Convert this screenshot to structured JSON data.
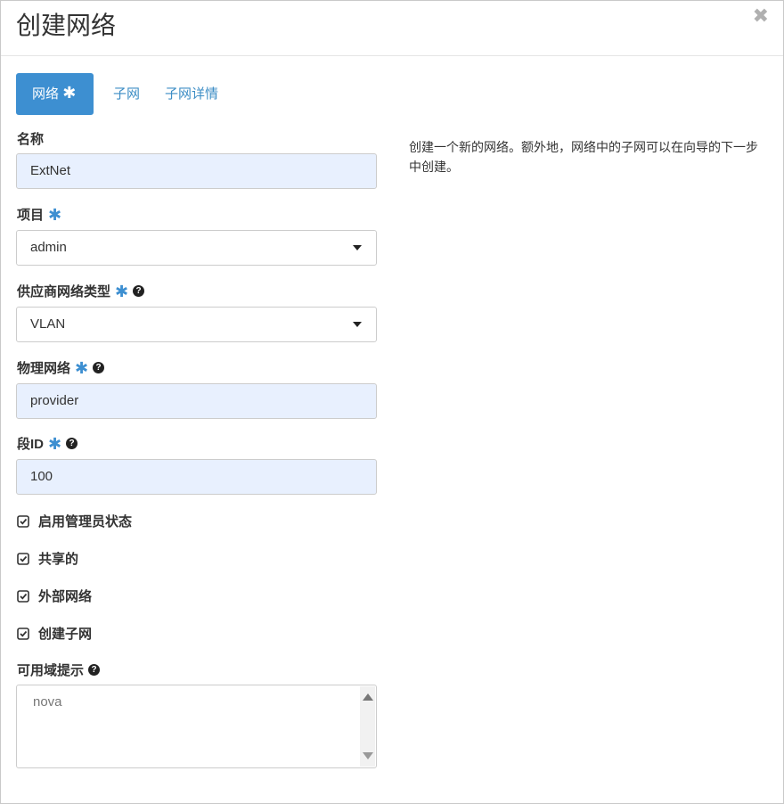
{
  "dialog": {
    "title": "创建网络",
    "close_glyph": "✖"
  },
  "tabs": [
    {
      "label": "网络",
      "required": "✱",
      "active": true
    },
    {
      "label": "子网",
      "active": false
    },
    {
      "label": "子网详情",
      "active": false
    }
  ],
  "form": {
    "name": {
      "label": "名称",
      "value": "ExtNet"
    },
    "project": {
      "label": "项目",
      "required": "✱",
      "value": "admin"
    },
    "provider_type": {
      "label": "供应商网络类型",
      "required": "✱",
      "help": "?",
      "value": "VLAN"
    },
    "physical_network": {
      "label": "物理网络",
      "required": "✱",
      "help": "?",
      "value": "provider"
    },
    "segment_id": {
      "label": "段ID",
      "required": "✱",
      "help": "?",
      "value": "100"
    },
    "checkboxes": [
      {
        "label": "启用管理员状态",
        "checked": true
      },
      {
        "label": "共享的",
        "checked": true
      },
      {
        "label": "外部网络",
        "checked": true
      },
      {
        "label": "创建子网",
        "checked": true
      }
    ],
    "az_hints": {
      "label": "可用域提示",
      "help": "?",
      "placeholder": "nova"
    }
  },
  "description": "创建一个新的网络。额外地，网络中的子网可以在向导的下一步中创建。",
  "colors": {
    "accent": "#3d8fd1",
    "link": "#3c8dc5",
    "filled_input": "#e8f0fe"
  }
}
